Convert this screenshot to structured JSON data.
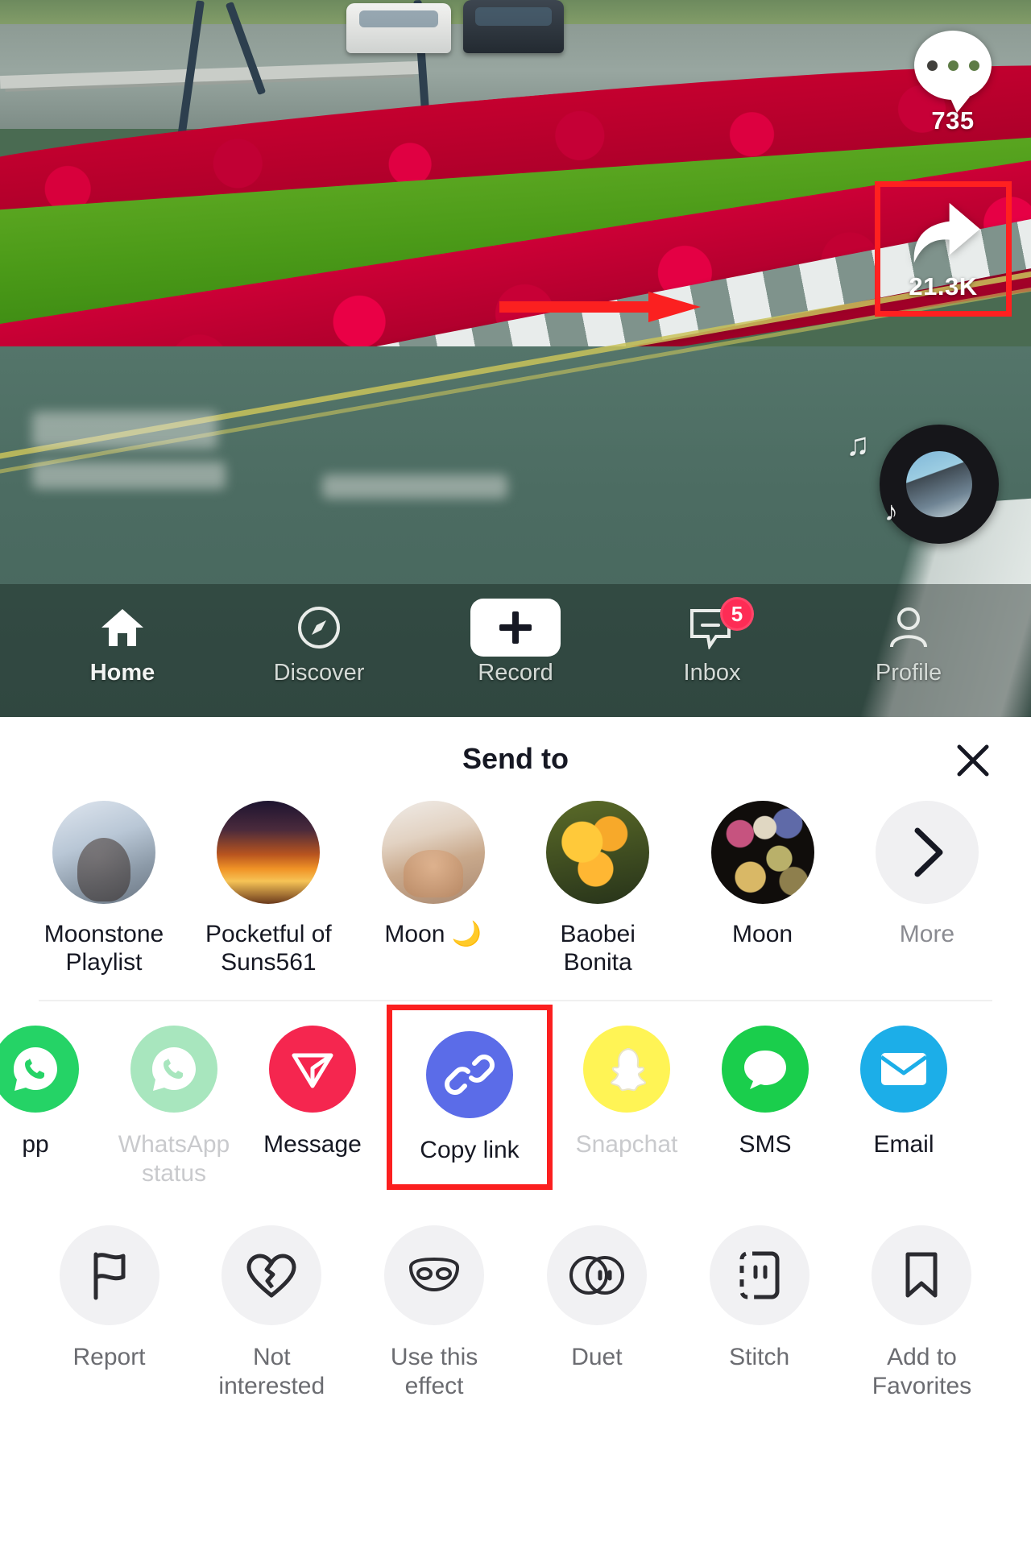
{
  "video": {
    "comment_count": "735",
    "share_count": "21.3K",
    "comment_icon": "comment-bubble-icon",
    "share_icon": "share-arrow-icon",
    "music_disc_icon": "music-disc-avatar",
    "annotation_arrow_color": "#ff2020",
    "annotation_box_color": "#ff2020"
  },
  "tabbar": {
    "items": [
      {
        "label": "Home",
        "icon": "home-icon",
        "active": true
      },
      {
        "label": "Discover",
        "icon": "compass-icon",
        "active": false
      },
      {
        "label": "Record",
        "icon": "plus-icon",
        "active": false
      },
      {
        "label": "Inbox",
        "icon": "inbox-icon",
        "active": false,
        "badge": "5"
      },
      {
        "label": "Profile",
        "icon": "person-icon",
        "active": false
      }
    ]
  },
  "sheet": {
    "title": "Send to",
    "close_icon": "close-icon",
    "contacts": [
      {
        "name": "Moonstone Playlist",
        "avatar": "av1",
        "type": "avatar"
      },
      {
        "name": "Pocketful of Suns561",
        "avatar": "av2",
        "type": "avatar"
      },
      {
        "name": "Moon 🌙",
        "avatar": "av3",
        "type": "avatar"
      },
      {
        "name": "Baobei Bonita",
        "avatar": "av4",
        "type": "avatar"
      },
      {
        "name": "Moon",
        "avatar": "av5",
        "type": "avatar"
      },
      {
        "name": "More",
        "avatar": "chevron-right-icon",
        "type": "more",
        "muted": true
      }
    ],
    "apps": [
      {
        "label": "pp",
        "icon": "whatsapp-icon",
        "color": "#25D366",
        "faded": false,
        "clipped": true
      },
      {
        "label": "WhatsApp status",
        "icon": "whatsapp-status-icon",
        "color": "#A8E6BE",
        "faded": true
      },
      {
        "label": "Message",
        "icon": "direct-message-icon",
        "color": "#F5264F",
        "faded": false
      },
      {
        "label": "Copy link",
        "icon": "chain-link-icon",
        "color": "#5B6CE8",
        "faded": false,
        "highlighted": true
      },
      {
        "label": "Snapchat",
        "icon": "snapchat-ghost-icon",
        "color": "#FFF455",
        "faded": true
      },
      {
        "label": "SMS",
        "icon": "sms-bubble-icon",
        "color": "#1ACE4C",
        "faded": false
      },
      {
        "label": "Email",
        "icon": "envelope-icon",
        "color": "#1CAEE8",
        "faded": false
      }
    ],
    "actions": [
      {
        "label": "Report",
        "icon": "flag-icon"
      },
      {
        "label": "Not interested",
        "icon": "broken-heart-icon"
      },
      {
        "label": "Use this effect",
        "icon": "mask-icon"
      },
      {
        "label": "Duet",
        "icon": "duet-circles-icon"
      },
      {
        "label": "Stitch",
        "icon": "stitch-icon"
      },
      {
        "label": "Add to Favorites",
        "icon": "bookmark-icon"
      }
    ]
  }
}
